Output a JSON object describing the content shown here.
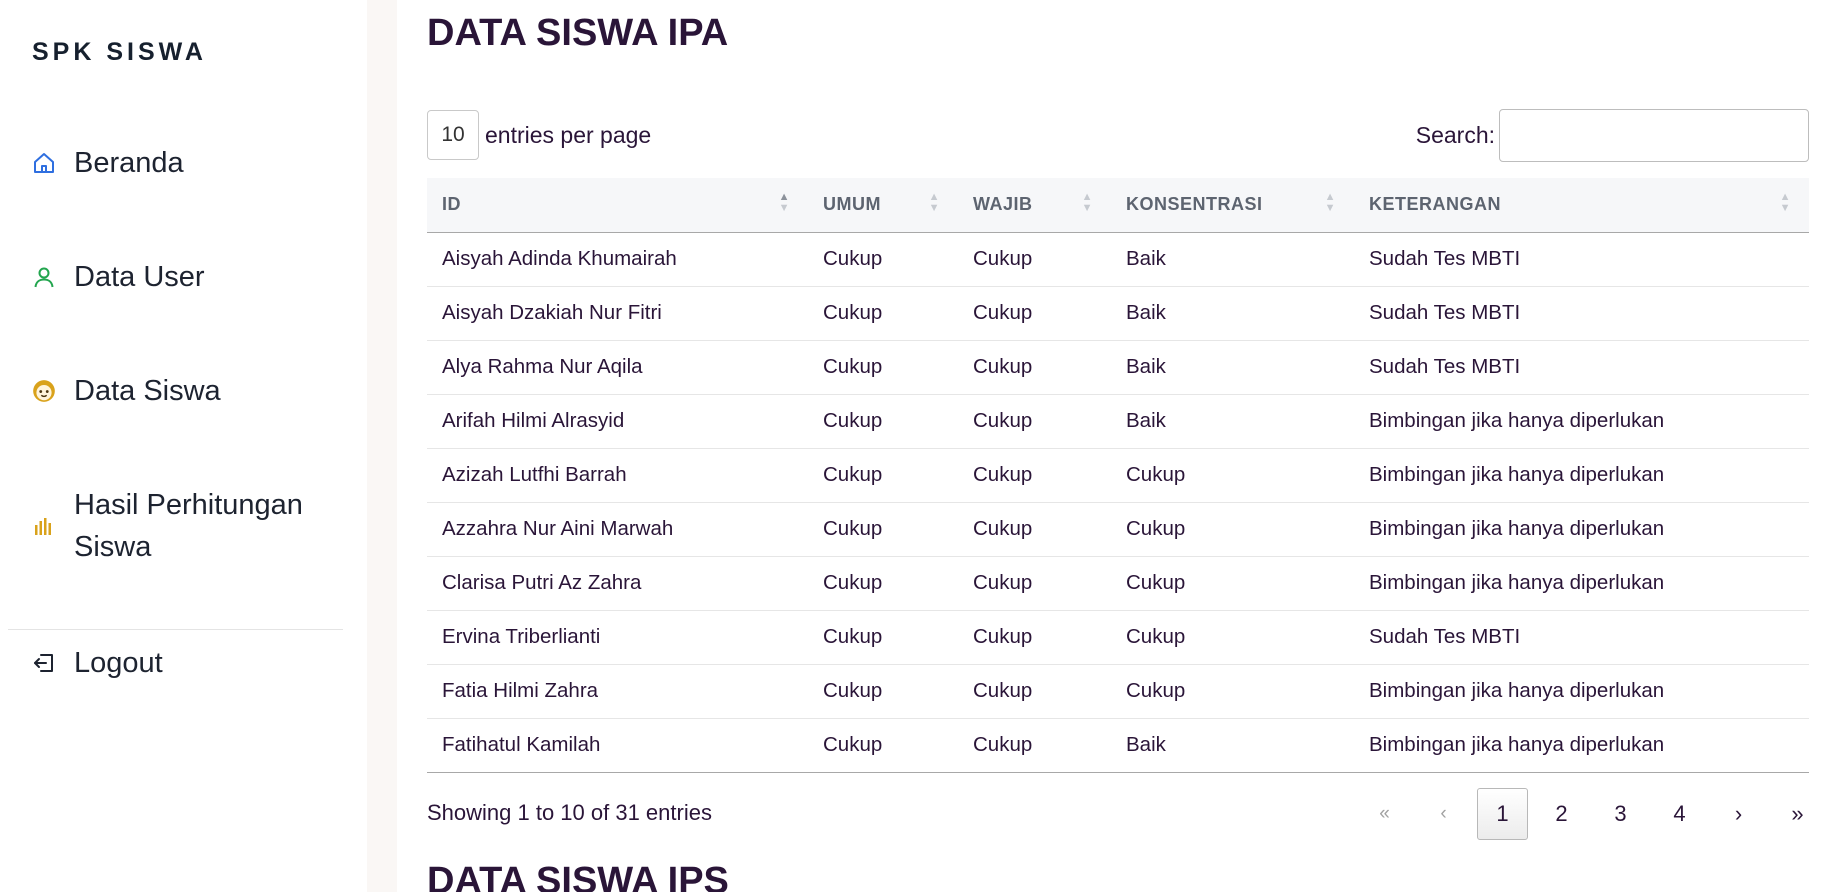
{
  "sidebar": {
    "brand": "SPK SISWA",
    "items": [
      {
        "label": "Beranda",
        "icon": "home-icon",
        "color": "#2f6fe0"
      },
      {
        "label": "Data User",
        "icon": "user-icon",
        "color": "#22a54e"
      },
      {
        "label": "Data Siswa",
        "icon": "face-icon",
        "color": "#d9a21b"
      },
      {
        "label": "Hasil Perhitungan Siswa",
        "icon": "bar-chart-icon",
        "color": "#d9a21b"
      },
      {
        "label": "Logout",
        "icon": "logout-icon",
        "color": "#1d2330"
      }
    ]
  },
  "main": {
    "title": "DATA SISWA IPA",
    "entries_value": "10",
    "entries_label": "entries per page",
    "search_label": "Search:",
    "search_value": "",
    "columns": [
      "ID",
      "UMUM",
      "WAJIB",
      "KONSENTRASI",
      "KETERANGAN"
    ],
    "rows": [
      [
        "Aisyah Adinda Khumairah",
        "Cukup",
        "Cukup",
        "Baik",
        "Sudah Tes MBTI"
      ],
      [
        "Aisyah Dzakiah Nur Fitri",
        "Cukup",
        "Cukup",
        "Baik",
        "Sudah Tes MBTI"
      ],
      [
        "Alya Rahma Nur Aqila",
        "Cukup",
        "Cukup",
        "Baik",
        "Sudah Tes MBTI"
      ],
      [
        "Arifah Hilmi Alrasyid",
        "Cukup",
        "Cukup",
        "Baik",
        "Bimbingan jika hanya diperlukan"
      ],
      [
        "Azizah Lutfhi Barrah",
        "Cukup",
        "Cukup",
        "Cukup",
        "Bimbingan jika hanya diperlukan"
      ],
      [
        "Azzahra Nur Aini Marwah",
        "Cukup",
        "Cukup",
        "Cukup",
        "Bimbingan jika hanya diperlukan"
      ],
      [
        "Clarisa Putri Az Zahra",
        "Cukup",
        "Cukup",
        "Cukup",
        "Bimbingan jika hanya diperlukan"
      ],
      [
        "Ervina Triberlianti",
        "Cukup",
        "Cukup",
        "Cukup",
        "Sudah Tes MBTI"
      ],
      [
        "Fatia Hilmi Zahra",
        "Cukup",
        "Cukup",
        "Cukup",
        "Bimbingan jika hanya diperlukan"
      ],
      [
        "Fatihatul Kamilah",
        "Cukup",
        "Cukup",
        "Baik",
        "Bimbingan jika hanya diperlukan"
      ]
    ],
    "info": "Showing 1 to 10 of 31 entries",
    "pagination": {
      "first": "«",
      "prev": "‹",
      "pages": [
        "1",
        "2",
        "3",
        "4"
      ],
      "current": "1",
      "next": "›",
      "last": "»"
    },
    "next_section_title": "DATA SISWA IPS"
  }
}
